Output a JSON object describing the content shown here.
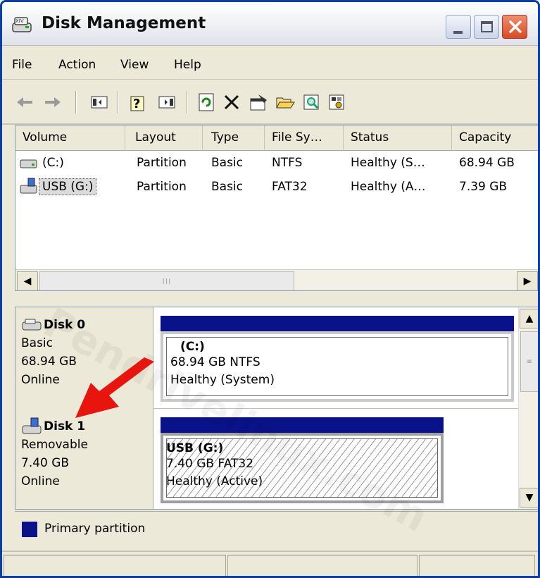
{
  "window": {
    "title": "Disk Management"
  },
  "menu": [
    "File",
    "Action",
    "View",
    "Help"
  ],
  "toolbar_icons": [
    "back-icon",
    "forward-icon",
    "console-tree-icon",
    "help-icon",
    "action-pane-icon",
    "refresh-icon",
    "delete-icon",
    "properties-icon",
    "open-icon",
    "explore-icon",
    "settings-icon"
  ],
  "volumes": {
    "columns": [
      "Volume",
      "Layout",
      "Type",
      "File Sy…",
      "Status",
      "Capacity"
    ],
    "rows": [
      {
        "volume": "(C:)",
        "layout": "Partition",
        "type": "Basic",
        "fs": "NTFS",
        "status": "Healthy (S…",
        "capacity": "68.94 GB"
      },
      {
        "volume": "USB (G:)",
        "layout": "Partition",
        "type": "Basic",
        "fs": "FAT32",
        "status": "Healthy (A…",
        "capacity": "7.39 GB"
      }
    ],
    "scroll_grip": "III"
  },
  "disks": [
    {
      "name": "Disk 0",
      "kind": "Basic",
      "size": "68.94 GB",
      "state": "Online",
      "partition": {
        "title": "(C:)",
        "detail": "68.94 GB NTFS",
        "status": "Healthy (System)"
      }
    },
    {
      "name": "Disk 1",
      "kind": "Removable",
      "size": "7.40 GB",
      "state": "Online",
      "partition": {
        "title": "USB  (G:)",
        "detail": "7.40 GB FAT32",
        "status": "Healthy (Active)"
      }
    }
  ],
  "legend": {
    "label": "Primary partition",
    "color": "#0a1289"
  },
  "watermark": "Pendrivelinux.com",
  "colors": {
    "partition_header": "#0a1289",
    "window_border": "#0a3ea8",
    "close_button": "#d94a22",
    "arrow": "#e8150e"
  }
}
